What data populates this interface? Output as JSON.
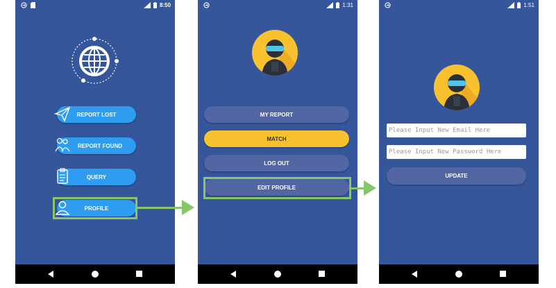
{
  "screen1": {
    "status_time": "8:50",
    "buttons": [
      {
        "label": "REPORT LOST",
        "icon": "paper-plane-icon"
      },
      {
        "label": "REPORT FOUND",
        "icon": "people-icon"
      },
      {
        "label": "QUERY",
        "icon": "clipboard-icon"
      },
      {
        "label": "PROFILE",
        "icon": "user-icon"
      }
    ]
  },
  "screen2": {
    "status_time": "1:31",
    "buttons": [
      {
        "label": "MY REPORT"
      },
      {
        "label": "MATCH"
      },
      {
        "label": "LOG OUT"
      },
      {
        "label": "EDIT PROFILE"
      }
    ]
  },
  "screen3": {
    "status_time": "1:51",
    "email_placeholder": "Please Input New Email Here",
    "password_placeholder": "Please Input New Password Here",
    "update_label": "UPDATE"
  },
  "colors": {
    "phone_background": "#35569A",
    "menu_button": "#2E9CF1",
    "profile_button": "#5266A4",
    "match_button": "#F8C12E",
    "highlight": "#86C76A"
  }
}
